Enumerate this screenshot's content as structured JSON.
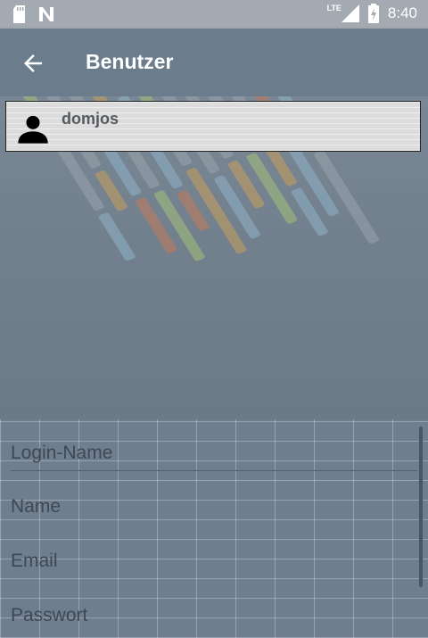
{
  "status_bar": {
    "time": "8:40",
    "network": "LTE",
    "icons": [
      "sd-card-icon",
      "n-notification-icon",
      "signal-icon",
      "battery-charging-icon"
    ]
  },
  "app_bar": {
    "title": "Benutzer",
    "back_icon": "arrow-back-icon"
  },
  "user_list": [
    {
      "username": "domjos",
      "icon": "person-icon"
    }
  ],
  "form": {
    "login_name": {
      "placeholder": "Login-Name",
      "value": ""
    },
    "name": {
      "placeholder": "Name",
      "value": ""
    },
    "email": {
      "placeholder": "Email",
      "value": ""
    },
    "password": {
      "placeholder": "Passwort",
      "value": ""
    }
  },
  "colors": {
    "app_bar": "#6b7c8d",
    "status_bar": "#a3aab1",
    "card": "#dcdcdc"
  }
}
